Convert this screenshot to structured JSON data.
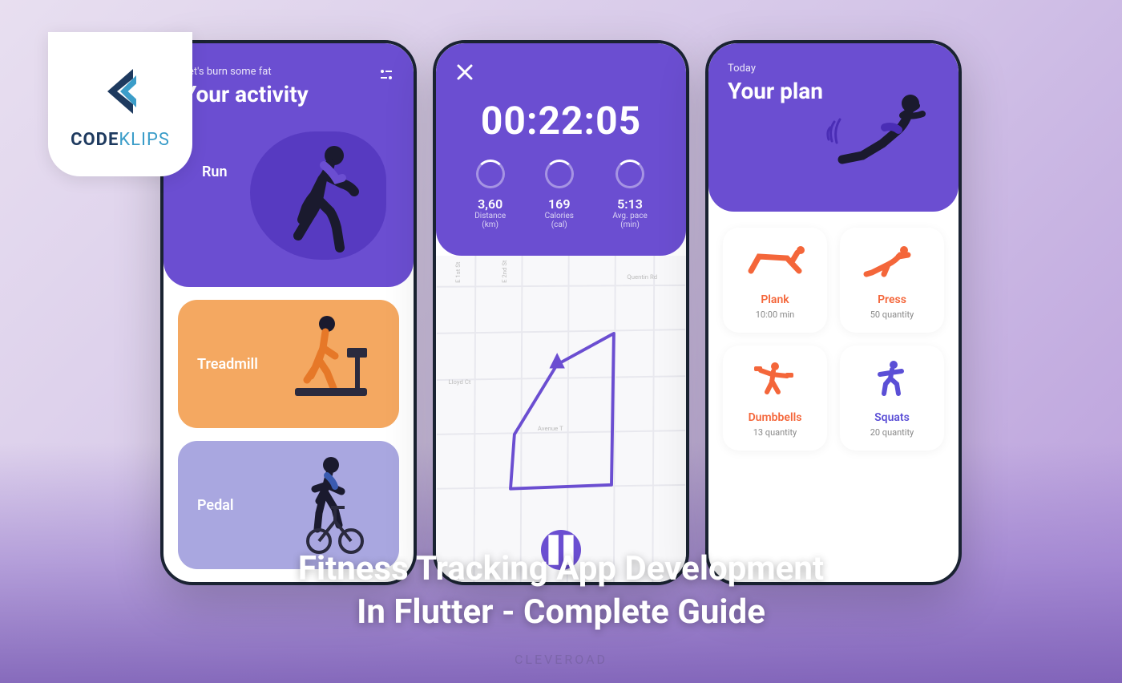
{
  "logo": {
    "brand1": "CODE",
    "brand2": "KLIPS"
  },
  "hero": {
    "title_line1": "Fitness Tracking App Development",
    "title_line2": "In Flutter - Complete Guide"
  },
  "watermark": "CLEVEROAD",
  "phone1": {
    "subtitle": "Let's burn some fat",
    "title": "Your activity",
    "featured": "Run",
    "activities": [
      {
        "name": "Treadmill"
      },
      {
        "name": "Pedal"
      }
    ]
  },
  "phone2": {
    "timer": "00:22:05",
    "stats": [
      {
        "value": "3,60",
        "label": "Distance",
        "unit": "(km)"
      },
      {
        "value": "169",
        "label": "Calories",
        "unit": "(cal)"
      },
      {
        "value": "5:13",
        "label": "Avg. pace",
        "unit": "(min)"
      }
    ]
  },
  "phone3": {
    "subtitle": "Today",
    "title": "Your plan",
    "exercises": [
      {
        "name": "Plank",
        "detail": "10:00 min",
        "color": "orange"
      },
      {
        "name": "Press",
        "detail": "50 quantity",
        "color": "orange"
      },
      {
        "name": "Dumbbells",
        "detail": "13 quantity",
        "color": "orange"
      },
      {
        "name": "Squats",
        "detail": "20 quantity",
        "color": "blue"
      }
    ]
  }
}
